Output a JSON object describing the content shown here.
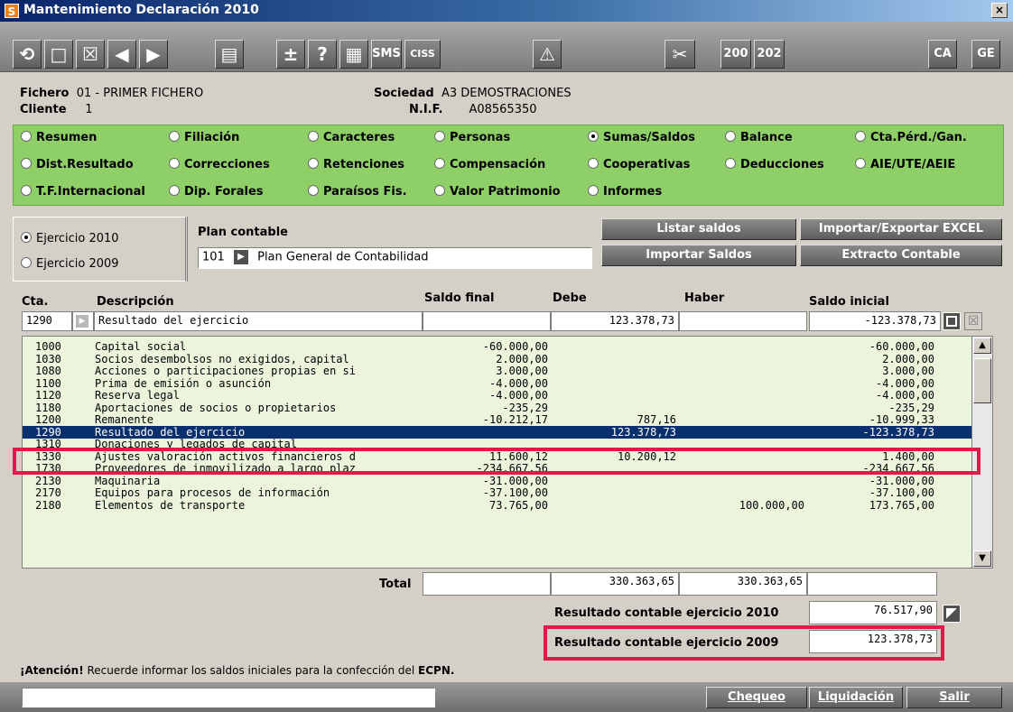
{
  "window": {
    "title": "Mantenimiento Declaración 2010",
    "logo": "S",
    "close_glyph": "×"
  },
  "toolbar": {
    "buttons": [
      {
        "name": "refresh-icon",
        "glyph": "⟲"
      },
      {
        "name": "new-icon",
        "glyph": "□"
      },
      {
        "name": "delete-icon",
        "glyph": "☒"
      },
      {
        "name": "prev-icon",
        "glyph": "◀"
      },
      {
        "name": "next-icon",
        "glyph": "▶"
      },
      {
        "name": "print-icon",
        "glyph": "▤"
      },
      {
        "name": "plus-minus-icon",
        "glyph": "±"
      },
      {
        "name": "help-icon",
        "glyph": "?"
      },
      {
        "name": "calculator-icon",
        "glyph": "▦"
      },
      {
        "name": "sms-icon",
        "glyph": "SMS"
      },
      {
        "name": "ciss-icon",
        "glyph": "CISS"
      },
      {
        "name": "warning-icon",
        "glyph": "⚠"
      },
      {
        "name": "tools-icon",
        "glyph": "✂"
      },
      {
        "name": "model-200-icon",
        "glyph": "200"
      },
      {
        "name": "model-202-icon",
        "glyph": "202"
      },
      {
        "name": "ca-icon",
        "glyph": "CA"
      },
      {
        "name": "ge-icon",
        "glyph": "GE"
      }
    ]
  },
  "header": {
    "fichero_label": "Fichero",
    "fichero_value": "01 - PRIMER FICHERO",
    "cliente_label": "Cliente",
    "cliente_value": "1",
    "sociedad_label": "Sociedad",
    "sociedad_value": "A3 DEMOSTRACIONES",
    "nif_label": "N.I.F.",
    "nif_value": "A08565350"
  },
  "sections": [
    {
      "label": "Resumen",
      "selected": false
    },
    {
      "label": "Filiación",
      "selected": false
    },
    {
      "label": "Caracteres",
      "selected": false
    },
    {
      "label": "Personas",
      "selected": false
    },
    {
      "label": "Sumas/Saldos",
      "selected": true
    },
    {
      "label": "Balance",
      "selected": false
    },
    {
      "label": "Cta.Pérd./Gan.",
      "selected": false
    },
    {
      "label": "Dist.Resultado",
      "selected": false
    },
    {
      "label": "Correcciones",
      "selected": false
    },
    {
      "label": "Retenciones",
      "selected": false
    },
    {
      "label": "Compensación",
      "selected": false
    },
    {
      "label": "Cooperativas",
      "selected": false
    },
    {
      "label": "Deducciones",
      "selected": false
    },
    {
      "label": "AIE/UTE/AEIE",
      "selected": false
    },
    {
      "label": "T.F.Internacional",
      "selected": false
    },
    {
      "label": "Dip. Forales",
      "selected": false
    },
    {
      "label": "Paraísos Fis.",
      "selected": false
    },
    {
      "label": "Valor Patrimonio",
      "selected": false
    },
    {
      "label": "Informes",
      "selected": false
    }
  ],
  "ejercicio": {
    "option_2010": "Ejercicio 2010",
    "option_2009": "Ejercicio 2009",
    "selected": "2010"
  },
  "plan": {
    "label": "Plan contable",
    "code": "101",
    "name": "Plan General de Contabilidad"
  },
  "actions": {
    "listar": "Listar saldos",
    "importar_excel": "Importar/Exportar EXCEL",
    "importar_saldos": "Importar Saldos",
    "extracto": "Extracto Contable"
  },
  "table": {
    "headers": {
      "cta": "Cta.",
      "descripcion": "Descripción",
      "saldo_final": "Saldo final",
      "debe": "Debe",
      "haber": "Haber",
      "saldo_inicial": "Saldo inicial"
    },
    "edit_row": {
      "cta": "1290",
      "descripcion": "Resultado del ejercicio",
      "saldo_final": "",
      "debe": "123.378,73",
      "haber": "",
      "saldo_inicial": "-123.378,73"
    },
    "rows": [
      {
        "cta": "1000",
        "desc": "Capital social",
        "saldo_final": "-60.000,00",
        "debe": "",
        "haber": "",
        "saldo_inicial": "-60.000,00"
      },
      {
        "cta": "1030",
        "desc": "Socios desembolsos no exigidos, capital",
        "saldo_final": "2.000,00",
        "debe": "",
        "haber": "",
        "saldo_inicial": "2.000,00"
      },
      {
        "cta": "1080",
        "desc": "Acciones o participaciones propias en si",
        "saldo_final": "3.000,00",
        "debe": "",
        "haber": "",
        "saldo_inicial": "3.000,00"
      },
      {
        "cta": "1100",
        "desc": "Prima de emisión o asunción",
        "saldo_final": "-4.000,00",
        "debe": "",
        "haber": "",
        "saldo_inicial": "-4.000,00"
      },
      {
        "cta": "1120",
        "desc": "Reserva legal",
        "saldo_final": "-4.000,00",
        "debe": "",
        "haber": "",
        "saldo_inicial": "-4.000,00"
      },
      {
        "cta": "1180",
        "desc": "Aportaciones de socios o propietarios",
        "saldo_final": "-235,29",
        "debe": "",
        "haber": "",
        "saldo_inicial": "-235,29"
      },
      {
        "cta": "1200",
        "desc": "Remanente",
        "saldo_final": "-10.212,17",
        "debe": "787,16",
        "haber": "",
        "saldo_inicial": "-10.999,33"
      },
      {
        "cta": "1290",
        "desc": "Resultado del ejercicio",
        "saldo_final": "",
        "debe": "123.378,73",
        "haber": "",
        "saldo_inicial": "-123.378,73",
        "selected": true
      },
      {
        "cta": "1310",
        "desc": "Donaciones y legados de capital",
        "saldo_final": "",
        "debe": "",
        "haber": "",
        "saldo_inicial": ""
      },
      {
        "cta": "1330",
        "desc": "Ajustes valoración activos financieros d",
        "saldo_final": "11.600,12",
        "debe": "10.200,12",
        "haber": "",
        "saldo_inicial": "1.400,00"
      },
      {
        "cta": "1730",
        "desc": "Proveedores de inmovilizado a largo plaz",
        "saldo_final": "-234.667,56",
        "debe": "",
        "haber": "",
        "saldo_inicial": "-234.667,56"
      },
      {
        "cta": "2130",
        "desc": "Maquinaria",
        "saldo_final": "-31.000,00",
        "debe": "",
        "haber": "",
        "saldo_inicial": "-31.000,00"
      },
      {
        "cta": "2170",
        "desc": "Equipos para procesos de información",
        "saldo_final": "-37.100,00",
        "debe": "",
        "haber": "",
        "saldo_inicial": "-37.100,00"
      },
      {
        "cta": "2180",
        "desc": "Elementos de transporte",
        "saldo_final": "73.765,00",
        "debe": "",
        "haber": "100.000,00",
        "saldo_inicial": "173.765,00"
      }
    ]
  },
  "totals": {
    "label": "Total",
    "saldo_final": "",
    "debe": "330.363,65",
    "haber": "330.363,65",
    "saldo_inicial": ""
  },
  "results": {
    "label_2010": "Resultado contable ejercicio 2010",
    "value_2010": "76.517,90",
    "label_2009": "Resultado contable ejercicio 2009",
    "value_2009": "123.378,73"
  },
  "notice": {
    "bold": "¡Atención!",
    "text": " Recuerde informar los saldos iniciales para la confección del ",
    "tail": "ECPN."
  },
  "footer": {
    "status_text": "",
    "chequeo": "Chequeo",
    "liquidacion": "Liquidación",
    "salir": "Salir"
  },
  "colors": {
    "section_bg": "#8fcf68",
    "list_bg": "#eaf5dc",
    "selection": "#0a2f6e",
    "highlight": "#e4174b"
  }
}
